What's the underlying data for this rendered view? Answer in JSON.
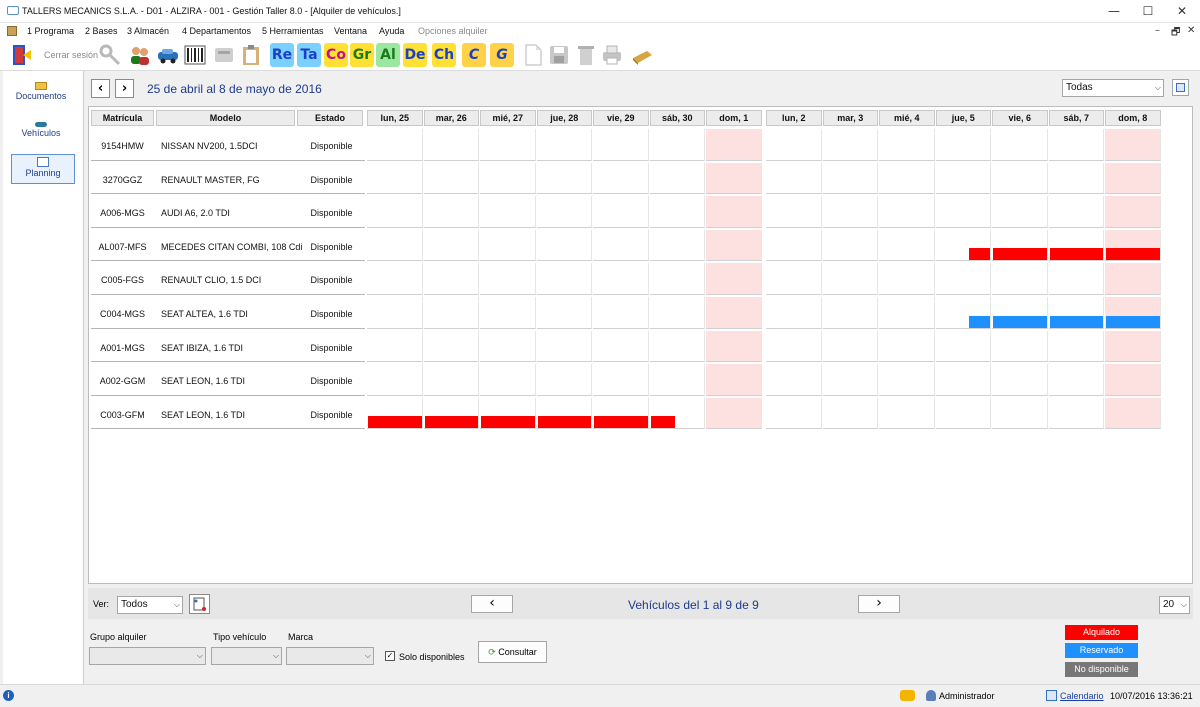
{
  "window": {
    "title": "TALLERS MECANICS S.L.A. - D01 - ALZIRA - 001 - Gestión Taller 8.0 - [Alquiler de vehículos.]",
    "minimize": "—",
    "maximize": "☐",
    "close": "✕"
  },
  "menu": {
    "items": [
      "1 Programa",
      "2 Bases",
      "3 Almacén",
      "4 Departamentos",
      "5 Herramientas",
      "Ventana",
      "Ayuda"
    ],
    "disabled_item": "Opciones alquiler",
    "mdi_buttons": [
      "–",
      "🗗",
      "✕"
    ]
  },
  "toolbar": {
    "logout_label": "Cerrar sesión",
    "text_buttons": [
      {
        "label": "Re",
        "fg": "#1a40c8",
        "bg": "#7ad0ff"
      },
      {
        "label": "Ta",
        "fg": "#1a40c8",
        "bg": "#7ad0ff"
      },
      {
        "label": "Co",
        "fg": "#c0108a",
        "bg": "#ffe033"
      },
      {
        "label": "Gr",
        "fg": "#1b7a1b",
        "bg": "#ffe033"
      },
      {
        "label": "Al",
        "fg": "#1b7a1b",
        "bg": "#9be7a0"
      },
      {
        "label": "De",
        "fg": "#1a40c8",
        "bg": "#ffe033"
      },
      {
        "label": "Ch",
        "fg": "#1a40c8",
        "bg": "#ffe033"
      },
      {
        "label": "C",
        "fg": "#1a40c8",
        "bg": "#ffd24a"
      },
      {
        "label": "G",
        "fg": "#1a40c8",
        "bg": "#ffd24a"
      }
    ]
  },
  "sidebar": {
    "items": [
      {
        "label": "Documentos",
        "icon": "folder-icon"
      },
      {
        "label": "Vehículos",
        "icon": "car-icon"
      },
      {
        "label": "Planning",
        "icon": "calendar-icon"
      }
    ]
  },
  "planning": {
    "period": "25 de abril al 8 de mayo de 2016",
    "filter": "Todas",
    "columns": {
      "plate": "Matrícula",
      "model": "Modelo",
      "status": "Estado"
    },
    "week1": [
      "lun, 25",
      "mar, 26",
      "mié, 27",
      "jue, 28",
      "vie, 29",
      "sáb, 30",
      "dom, 1"
    ],
    "week2": [
      "lun, 2",
      "mar, 3",
      "mié, 4",
      "jue, 5",
      "vie, 6",
      "sáb, 7",
      "dom, 8"
    ],
    "rows": [
      {
        "plate": "9154HMW",
        "model": "NISSAN NV200, 1.5DCI",
        "status": "Disponible",
        "bars": []
      },
      {
        "plate": "3270GGZ",
        "model": "RENAULT MASTER, FG",
        "status": "Disponible",
        "bars": []
      },
      {
        "plate": "A006-MGS",
        "model": "AUDI A6, 2.0 TDI",
        "status": "Disponible",
        "bars": []
      },
      {
        "plate": "AL007-MFS",
        "model": "MECEDES CITAN COMBI, 108 Cdi",
        "status": "Disponible",
        "bars": [
          {
            "kind": "alquilado",
            "days": [
              [
                10,
                0.6
              ],
              [
                11,
                0
              ],
              [
                12,
                0
              ],
              [
                13,
                0
              ]
            ]
          }
        ]
      },
      {
        "plate": "C005-FGS",
        "model": "RENAULT CLIO, 1.5 DCI",
        "status": "Disponible",
        "bars": []
      },
      {
        "plate": "C004-MGS",
        "model": "SEAT ALTEA, 1.6 TDI",
        "status": "Disponible",
        "bars": [
          {
            "kind": "reservado",
            "days": [
              [
                10,
                0.6
              ],
              [
                11,
                0
              ],
              [
                12,
                0
              ],
              [
                13,
                0
              ]
            ]
          }
        ]
      },
      {
        "plate": "A001-MGS",
        "model": "SEAT IBIZA, 1.6 TDI",
        "status": "Disponible",
        "bars": []
      },
      {
        "plate": "A002-GGM",
        "model": "SEAT LEON, 1.6 TDI",
        "status": "Disponible",
        "bars": []
      },
      {
        "plate": "C003-GFM",
        "model": "SEAT LEON, 1.6 TDI",
        "status": "Disponible",
        "bars": [
          {
            "kind": "alquilado",
            "days": [
              [
                0,
                0
              ],
              [
                1,
                0
              ],
              [
                2,
                0
              ],
              [
                3,
                0
              ],
              [
                4,
                0
              ],
              [
                5,
                -0.55
              ]
            ]
          }
        ]
      }
    ]
  },
  "footer": {
    "ver_label": "Ver:",
    "ver_value": "Todos",
    "pager_text": "Vehículos del 1 al 9 de 9",
    "page_size": "20",
    "grupo_label": "Grupo alquiler",
    "tipo_label": "Tipo vehículo",
    "marca_label": "Marca",
    "solo_label": "Solo disponibles",
    "solo_checked": "✓",
    "consultar": "Consultar"
  },
  "legend": [
    {
      "label": "Alquilado",
      "color": "#ff0000"
    },
    {
      "label": "Reservado",
      "color": "#1e90ff"
    },
    {
      "label": "No disponible",
      "color": "#777777"
    }
  ],
  "status": {
    "user": "Administrador",
    "calendar_link": "Calendario",
    "datetime": "10/07/2016 13:36:21"
  }
}
